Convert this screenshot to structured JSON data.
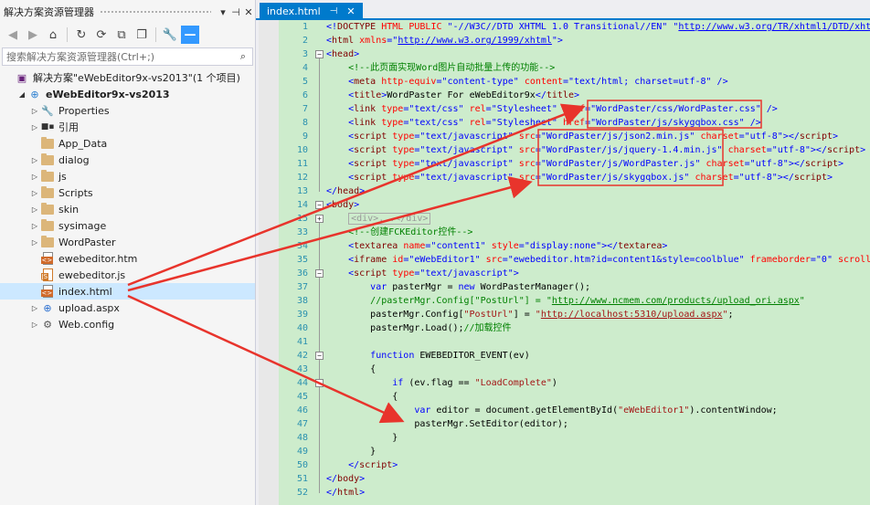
{
  "solution_explorer": {
    "title": "解决方案资源管理器",
    "search_placeholder": "搜索解决方案资源管理器(Ctrl+;)",
    "tree": [
      {
        "label": "解决方案\"eWebEditor9x-vs2013\"(1 个项目)",
        "icon": "solution-icon",
        "indent": 0,
        "arrow": ""
      },
      {
        "label": "eWebEditor9x-vs2013",
        "icon": "web-project-icon",
        "indent": 1,
        "arrow": "◢",
        "bold": true
      },
      {
        "label": "Properties",
        "icon": "wrench-icon",
        "indent": 2,
        "arrow": "▷"
      },
      {
        "label": "引用",
        "icon": "references-icon",
        "indent": 2,
        "arrow": "▷"
      },
      {
        "label": "App_Data",
        "icon": "folder-icon",
        "indent": 2,
        "arrow": ""
      },
      {
        "label": "dialog",
        "icon": "folder-icon",
        "indent": 2,
        "arrow": "▷"
      },
      {
        "label": "js",
        "icon": "folder-icon",
        "indent": 2,
        "arrow": "▷"
      },
      {
        "label": "Scripts",
        "icon": "folder-icon",
        "indent": 2,
        "arrow": "▷"
      },
      {
        "label": "skin",
        "icon": "folder-icon",
        "indent": 2,
        "arrow": "▷"
      },
      {
        "label": "sysimage",
        "icon": "folder-icon",
        "indent": 2,
        "arrow": "▷"
      },
      {
        "label": "WordPaster",
        "icon": "folder-icon",
        "indent": 2,
        "arrow": "▷"
      },
      {
        "label": "ewebeditor.htm",
        "icon": "html-file-icon",
        "indent": 2,
        "arrow": ""
      },
      {
        "label": "ewebeditor.js",
        "icon": "js-file-icon",
        "indent": 2,
        "arrow": ""
      },
      {
        "label": "index.html",
        "icon": "html-file-icon",
        "indent": 2,
        "arrow": "",
        "selected": true
      },
      {
        "label": "upload.aspx",
        "icon": "aspx-file-icon",
        "indent": 2,
        "arrow": "▷"
      },
      {
        "label": "Web.config",
        "icon": "config-file-icon",
        "indent": 2,
        "arrow": "▷"
      }
    ]
  },
  "editor": {
    "tab_label": "index.html",
    "line_numbers": [
      "1",
      "2",
      "3",
      "4",
      "5",
      "6",
      "7",
      "8",
      "9",
      "10",
      "11",
      "12",
      "13",
      "14",
      "15",
      "33",
      "34",
      "35",
      "36",
      "37",
      "38",
      "39",
      "40",
      "41",
      "42",
      "43",
      "44",
      "45",
      "46",
      "47",
      "48",
      "49",
      "50",
      "51",
      "52"
    ]
  },
  "colors": {
    "accent": "#007acc",
    "code_background": "#cdeccc",
    "annotation": "#e8342c",
    "selection": "#cce8ff"
  }
}
